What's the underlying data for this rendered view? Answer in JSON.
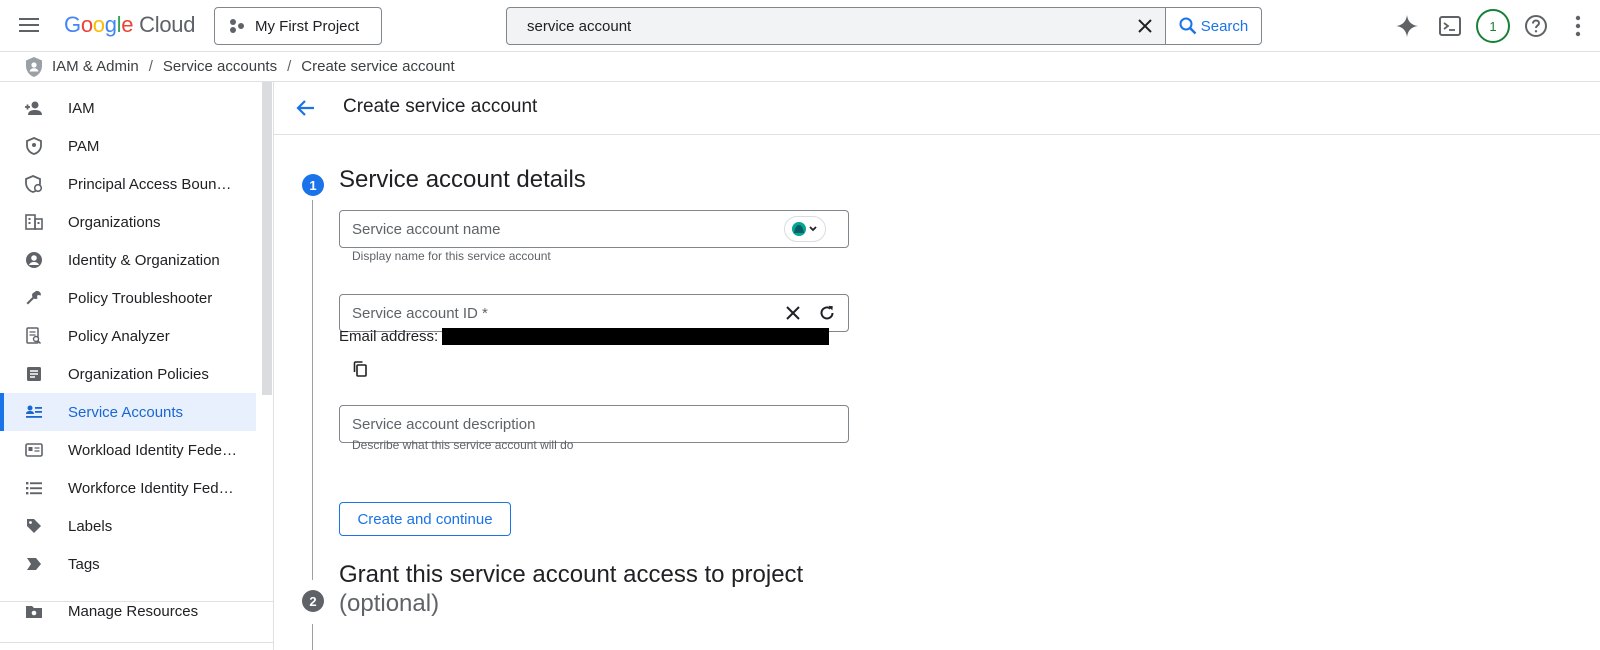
{
  "header": {
    "logo_google": "Google",
    "logo_cloud": "Cloud",
    "project_name": "My First Project",
    "search_value": "service account",
    "search_button": "Search",
    "notifications_count": "1"
  },
  "breadcrumb": {
    "root": "IAM & Admin",
    "parent": "Service accounts",
    "current": "Create service account"
  },
  "sidebar": {
    "items": [
      {
        "label": "IAM",
        "icon": "person-add-icon"
      },
      {
        "label": "PAM",
        "icon": "shield-icon"
      },
      {
        "label": "Principal Access Boun…",
        "icon": "shield-gear-icon"
      },
      {
        "label": "Organizations",
        "icon": "building-icon"
      },
      {
        "label": "Identity & Organization",
        "icon": "account-circle-icon"
      },
      {
        "label": "Policy Troubleshooter",
        "icon": "wrench-icon"
      },
      {
        "label": "Policy Analyzer",
        "icon": "document-search-icon"
      },
      {
        "label": "Organization Policies",
        "icon": "article-icon"
      },
      {
        "label": "Service Accounts",
        "icon": "service-account-icon",
        "active": true
      },
      {
        "label": "Workload Identity Fede…",
        "icon": "badge-icon"
      },
      {
        "label": "Workforce Identity Fed…",
        "icon": "list-icon"
      },
      {
        "label": "Labels",
        "icon": "tag-icon"
      },
      {
        "label": "Tags",
        "icon": "label-arrow-icon"
      }
    ],
    "manage_resources": "Manage Resources"
  },
  "page": {
    "title": "Create service account",
    "step1_number": "1",
    "step1_title": "Service account details",
    "name_placeholder": "Service account name",
    "name_hint": "Display name for this service account",
    "id_placeholder": "Service account ID *",
    "email_label": "Email address:",
    "description_placeholder": "Service account description",
    "description_hint": "Describe what this service account will do",
    "create_button": "Create and continue",
    "step2_number": "2",
    "step2_title": "Grant this service account access to project",
    "step2_optional": "(optional)"
  },
  "colors": {
    "accent": "#1a73e8",
    "active_bg": "#e8f0fe",
    "step_inactive": "#5f6368",
    "notif_green": "#188038"
  }
}
